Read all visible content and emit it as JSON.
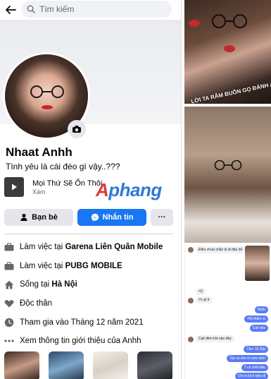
{
  "search": {
    "placeholder": "Tìm kiếm"
  },
  "profile": {
    "name": "Nhaat Anhh",
    "bio": "Tình yêu là cái đéo gì vậy..???",
    "song": {
      "title": "Mọi Thứ Sẽ Ổn Thôi",
      "subtitle": "Xám"
    },
    "watermark": "Aphang"
  },
  "actions": {
    "friends_label": "Bạn bè",
    "message_label": "Nhắn tin",
    "more_label": "···"
  },
  "info": [
    {
      "icon": "briefcase-icon",
      "prefix": "Làm việc tại ",
      "value": "Garena Liên Quân Mobile"
    },
    {
      "icon": "briefcase-icon",
      "prefix": "Làm việc tại ",
      "value": "PUBG MOBILE"
    },
    {
      "icon": "home-icon",
      "prefix": "Sống tại ",
      "value": "Hà Nội"
    },
    {
      "icon": "heart-icon",
      "prefix": "Độc thân",
      "value": ""
    },
    {
      "icon": "clock-icon",
      "prefix": "Tham gia vào Tháng 12 năm 2021",
      "value": ""
    },
    {
      "icon": "more-dots-icon",
      "prefix": "Xem thông tin giới thiệu của Anhh",
      "value": ""
    }
  ],
  "right": {
    "caption": "LỜI TA RĂM BUỒN GỌ ĐÁNH A NÓI ẤY",
    "chat": [
      {
        "dir": "in",
        "text": "Điêu chưa chắc là đi đâu bố"
      },
      {
        "dir": "in",
        "text": "=))"
      },
      {
        "dir": "in",
        "text": "Vc gì tr"
      },
      {
        "dir": "out",
        "text": "Hello"
      },
      {
        "dir": "out",
        "text": "Hỏi thăm m"
      },
      {
        "dir": "out",
        "text": "Call nha"
      },
      {
        "dir": "in",
        "text": "Call đêm khi nào đây"
      },
      {
        "dir": "out",
        "text": "Tầm 15 20p"
      },
      {
        "dir": "out",
        "text": "Tao ra cho m xem luôn"
      },
      {
        "dir": "out",
        "text": "T có chết đâu"
      },
      {
        "dir": "out",
        "text": "Cho k kích bữa đi"
      }
    ]
  },
  "colors": {
    "accent": "#1877f2",
    "text": "#050505",
    "muted": "#65676b",
    "button_gray": "#e4e6eb"
  }
}
